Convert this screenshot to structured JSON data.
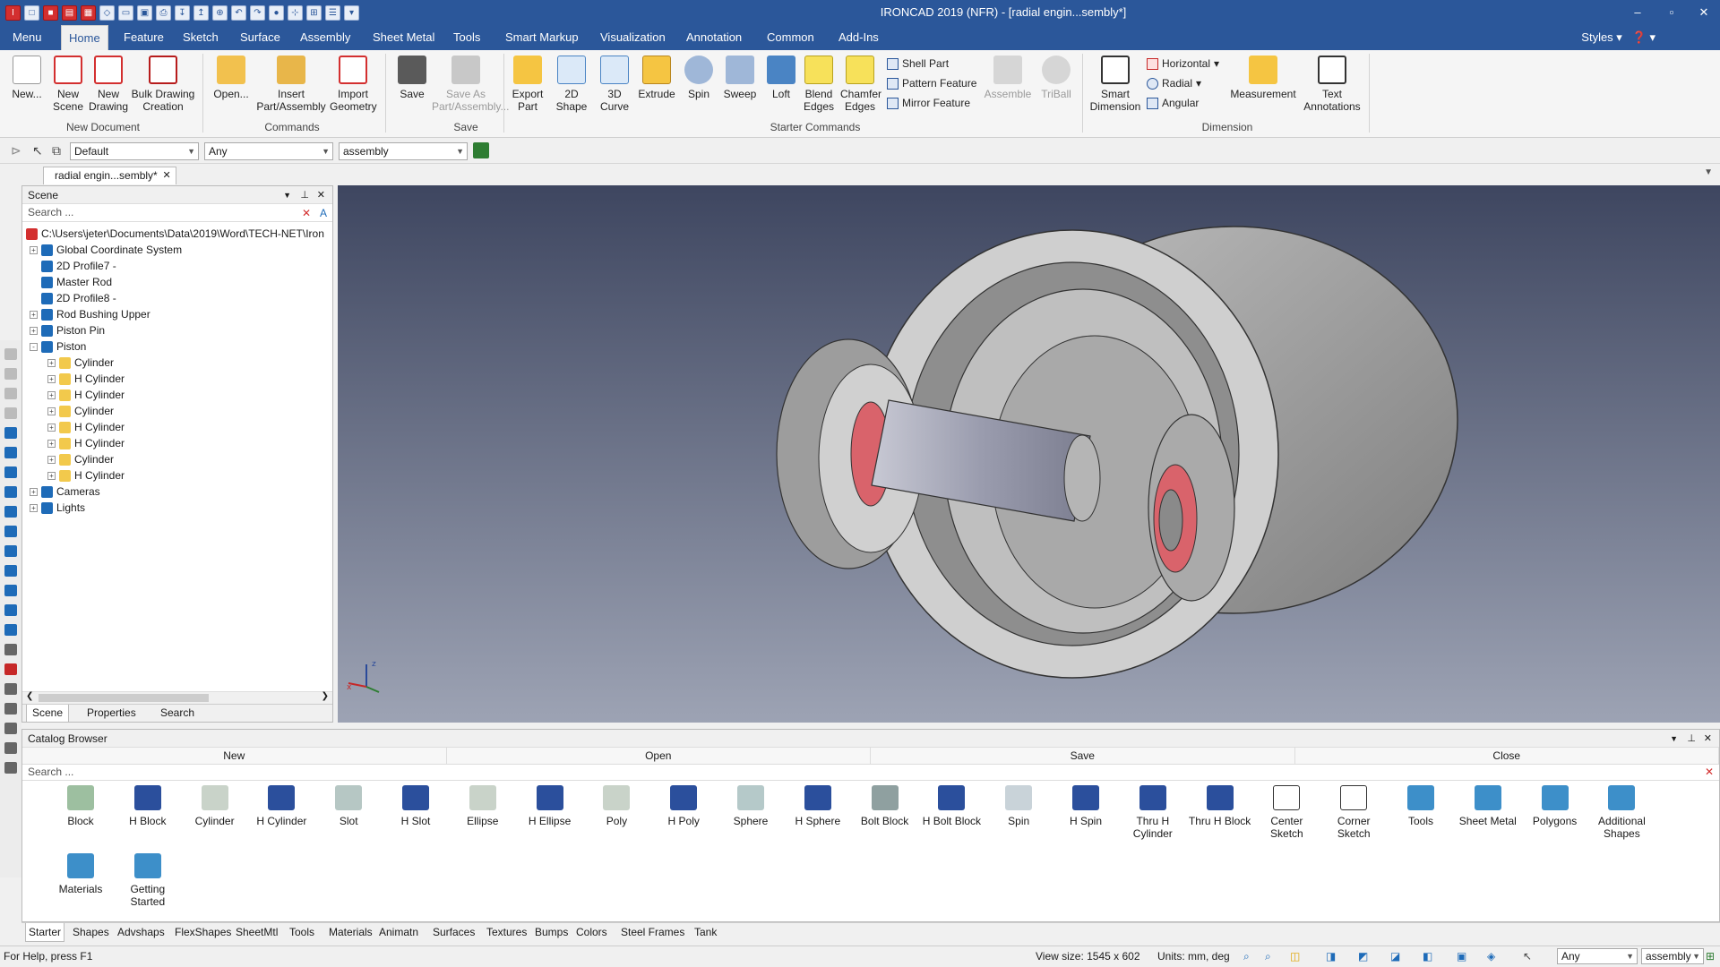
{
  "window": {
    "title": "IRONCAD 2019 (NFR) - [radial engin...sembly*]"
  },
  "menu": {
    "tabs": [
      "Menu",
      "Home",
      "Feature",
      "Sketch",
      "Surface",
      "Assembly",
      "Sheet Metal",
      "Tools",
      "Smart Markup",
      "Visualization",
      "Annotation",
      "Common",
      "Add-Ins"
    ],
    "styles_label": "Styles"
  },
  "ribbon": {
    "new_document": {
      "label": "New Document",
      "buttons": [
        "New...",
        "New Scene",
        "New Drawing",
        "Bulk Drawing Creation"
      ]
    },
    "commands": {
      "label": "Commands",
      "buttons": [
        "Open...",
        "Insert Part/Assembly",
        "Import Geometry"
      ]
    },
    "save": {
      "label": "Save",
      "buttons": [
        "Save",
        "Save As Part/Assembly..."
      ]
    },
    "starter": {
      "label": "Starter Commands",
      "buttons": [
        "Export Part",
        "2D Shape",
        "3D Curve",
        "Extrude",
        "Spin",
        "Sweep",
        "Loft",
        "Blend Edges",
        "Chamfer Edges"
      ],
      "small": [
        "Shell Part",
        "Pattern Feature",
        "Mirror Feature"
      ],
      "disabled": [
        "Assemble",
        "TriBall"
      ]
    },
    "dimension": {
      "label": "Dimension",
      "buttons": [
        "Smart Dimension",
        "Measurement",
        "Text Annotations"
      ],
      "small": [
        "Horizontal",
        "Radial",
        "Angular"
      ]
    }
  },
  "toolbar2": {
    "style_combo": "Default",
    "filter_combo": "Any",
    "level_combo": "assembly"
  },
  "doc_tab": {
    "label": "radial engin...sembly*"
  },
  "scene": {
    "title": "Scene",
    "search_placeholder": "Search ...",
    "root": "C:\\Users\\jeter\\Documents\\Data\\2019\\Word\\TECH-NET\\Iron",
    "items": [
      {
        "label": "Global Coordinate System",
        "level": 1,
        "expand": "+"
      },
      {
        "label": "2D Profile7 -",
        "level": 1,
        "expand": ""
      },
      {
        "label": "Master Rod",
        "level": 1,
        "expand": ""
      },
      {
        "label": "2D Profile8 -",
        "level": 1,
        "expand": ""
      },
      {
        "label": "Rod Bushing Upper",
        "level": 1,
        "expand": "+"
      },
      {
        "label": "Piston Pin",
        "level": 1,
        "expand": "+"
      },
      {
        "label": "Piston",
        "level": 1,
        "expand": "-"
      },
      {
        "label": "Cylinder",
        "level": 2,
        "expand": "+"
      },
      {
        "label": "H Cylinder",
        "level": 2,
        "expand": "+"
      },
      {
        "label": "H Cylinder",
        "level": 2,
        "expand": "+"
      },
      {
        "label": "Cylinder",
        "level": 2,
        "expand": "+"
      },
      {
        "label": "H Cylinder",
        "level": 2,
        "expand": "+"
      },
      {
        "label": "H Cylinder",
        "level": 2,
        "expand": "+"
      },
      {
        "label": "Cylinder",
        "level": 2,
        "expand": "+"
      },
      {
        "label": "H Cylinder",
        "level": 2,
        "expand": "+"
      },
      {
        "label": "Cameras",
        "level": 1,
        "expand": "+"
      },
      {
        "label": "Lights",
        "level": 1,
        "expand": "+"
      }
    ],
    "tabs": [
      "Scene",
      "Properties",
      "Search"
    ]
  },
  "catalog": {
    "title": "Catalog Browser",
    "actions": [
      "New",
      "Open",
      "Save",
      "Close"
    ],
    "search_placeholder": "Search ...",
    "items": [
      "Block",
      "H Block",
      "Cylinder",
      "H Cylinder",
      "Slot",
      "H Slot",
      "Ellipse",
      "H Ellipse",
      "Poly",
      "H Poly",
      "Sphere",
      "H Sphere",
      "Bolt Block",
      "H Bolt Block",
      "Spin",
      "H Spin",
      "Thru H Cylinder",
      "Thru H Block",
      "Center Sketch",
      "Corner Sketch",
      "Tools",
      "Sheet Metal",
      "Polygons",
      "Additional Shapes",
      "Materials",
      "Getting Started"
    ],
    "tabs": [
      "Starter",
      "Shapes",
      "Advshaps",
      "FlexShapes",
      "SheetMtl",
      "Tools",
      "Materials",
      "Animatn",
      "Surfaces",
      "Textures",
      "Bumps",
      "Colors",
      "Steel Frames",
      "Tank"
    ]
  },
  "status": {
    "help": "For Help, press F1",
    "view_size": "View size: 1545 x 602",
    "units": "Units: mm, deg",
    "filter": "Any",
    "level": "assembly"
  },
  "colors": {
    "accent": "#2b579a",
    "rubber": "#d9636b",
    "metal": "#c9c9cd"
  }
}
